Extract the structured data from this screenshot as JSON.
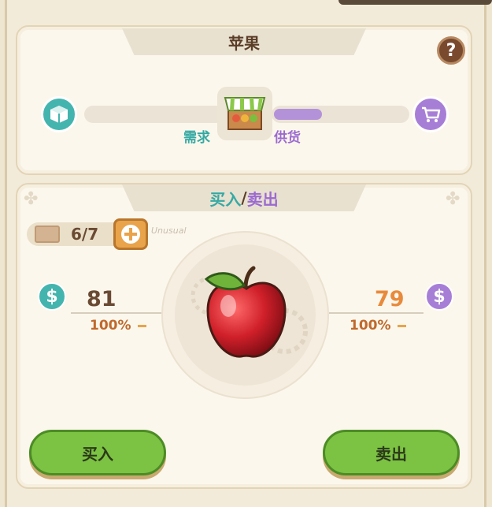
{
  "header": {
    "title": "苹果"
  },
  "market": {
    "demand_label": "需求",
    "supply_label": "供货",
    "supply_level": 0.35
  },
  "trade": {
    "tab_buy": "买入",
    "tab_slash": "/",
    "tab_sell": "卖出",
    "stock": "6/7",
    "scribble": "Unusual",
    "buy_price": "81",
    "sell_price": "79",
    "buy_percent": "100%",
    "sell_percent": "100%",
    "buy_button": "买入",
    "sell_button": "卖出"
  },
  "colors": {
    "buy_accent": "#44b4ae",
    "sell_accent": "#a77ed6",
    "button_green": "#7cc243",
    "price_orange": "#e88a3c"
  },
  "icons": [
    "help-icon",
    "box-icon",
    "shop-stall-icon",
    "cart-icon",
    "scroll-icon",
    "plus-icon",
    "dollar-coin-icon",
    "apple-icon"
  ]
}
